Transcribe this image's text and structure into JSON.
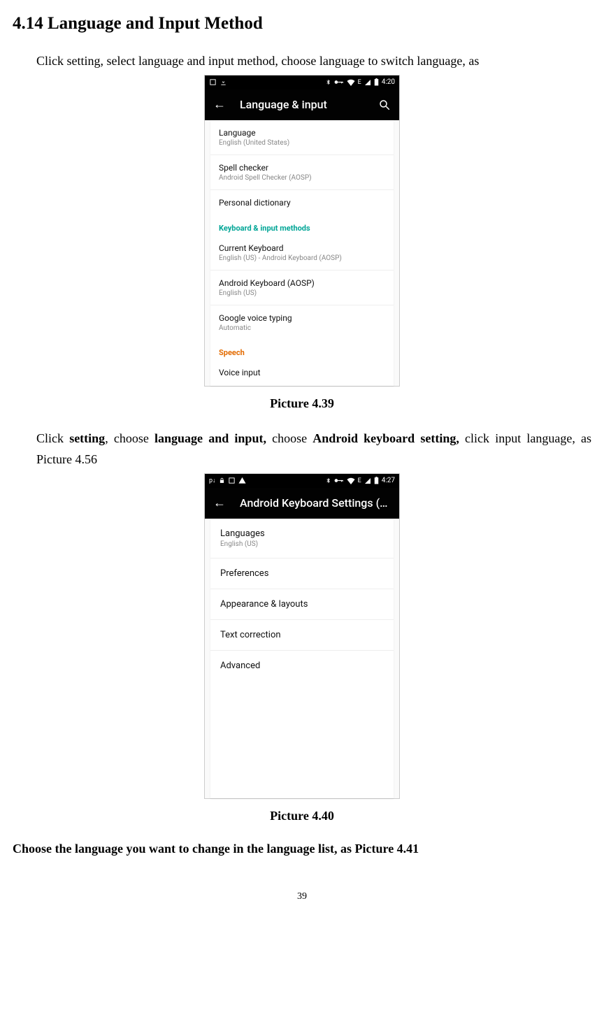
{
  "heading": "4.14  Language and Input Method",
  "intro": "Click setting, select language and input method, choose language to switch language, as",
  "caption1": "Picture 4.39",
  "para2_parts": {
    "p1": "Click ",
    "b1": "setting",
    "p2": ", choose ",
    "b2": "language and input,",
    "p3": " choose ",
    "b3": "Android keyboard setting,",
    "p4": " click input language, as Picture 4.56"
  },
  "caption2": "Picture 4.40",
  "strong_line": "Choose the language you want to change in the language list, as Picture 4.41",
  "page_number": "39",
  "phone1": {
    "status_time": "4:20",
    "status_left_labels": [
      "screenshot",
      "download"
    ],
    "appbar_title": "Language & input",
    "items": [
      {
        "title": "Language",
        "sub": "English (United States)"
      },
      {
        "title": "Spell checker",
        "sub": "Android Spell Checker (AOSP)"
      },
      {
        "title": "Personal dictionary",
        "sub": ""
      }
    ],
    "header1": "Keyboard & input methods",
    "items2": [
      {
        "title": "Current Keyboard",
        "sub": "English (US) - Android Keyboard (AOSP)"
      },
      {
        "title": "Android Keyboard (AOSP)",
        "sub": "English (US)"
      },
      {
        "title": "Google voice typing",
        "sub": "Automatic"
      }
    ],
    "header2": "Speech",
    "items3": [
      {
        "title": "Voice input",
        "sub": ""
      }
    ]
  },
  "phone2": {
    "status_time": "4:27",
    "appbar_title": "Android Keyboard Settings (A...",
    "items": [
      {
        "title": "Languages",
        "sub": "English (US)"
      },
      {
        "title": "Preferences",
        "sub": ""
      },
      {
        "title": "Appearance & layouts",
        "sub": ""
      },
      {
        "title": "Text correction",
        "sub": ""
      },
      {
        "title": "Advanced",
        "sub": ""
      }
    ]
  }
}
